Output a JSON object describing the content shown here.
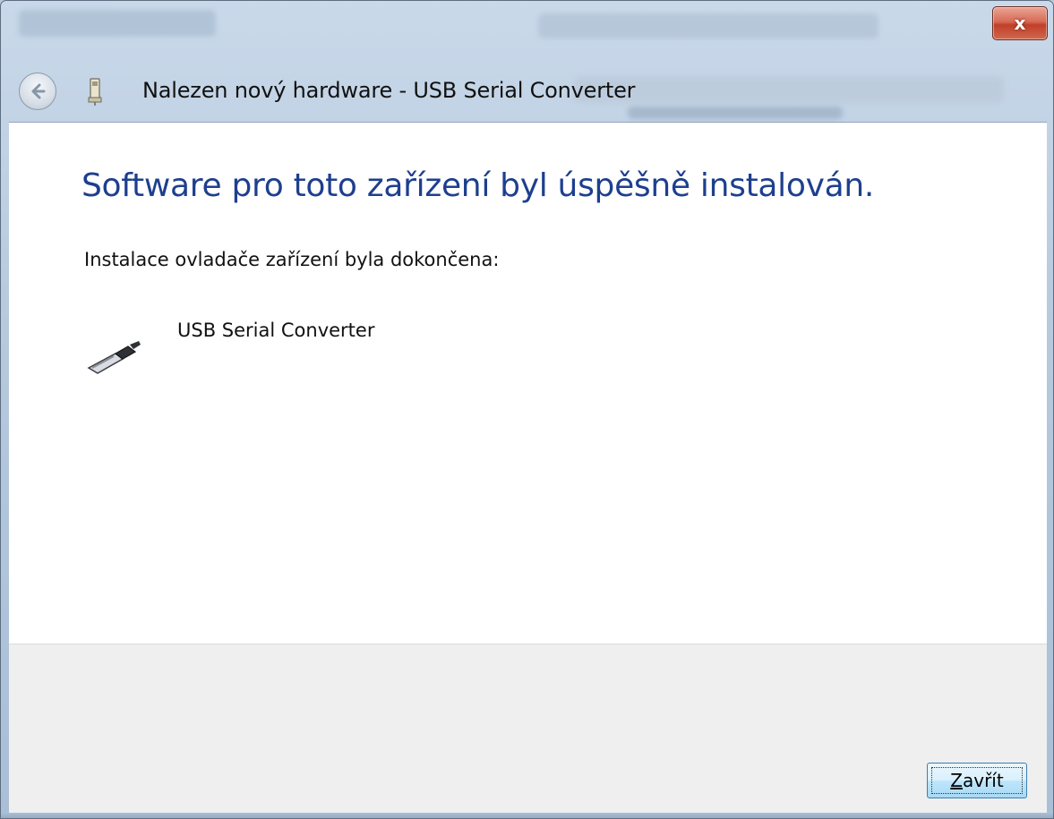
{
  "window": {
    "title": "Nalezen nový hardware - USB Serial Converter",
    "close_glyph": "x",
    "back_glyph": "←"
  },
  "content": {
    "heading": "Software pro toto zařízení byl úspěšně instalován.",
    "subtitle": "Instalace ovladače zařízení byla dokončena:",
    "device": {
      "name": "USB Serial Converter",
      "icon": "usb-plug-icon"
    }
  },
  "footer": {
    "close_button_mnemonic": "Z",
    "close_button_rest": "avřít"
  },
  "colors": {
    "heading": "#1e3f8f",
    "close_button_red": "#c0402a",
    "footer_bg": "#efefef"
  }
}
